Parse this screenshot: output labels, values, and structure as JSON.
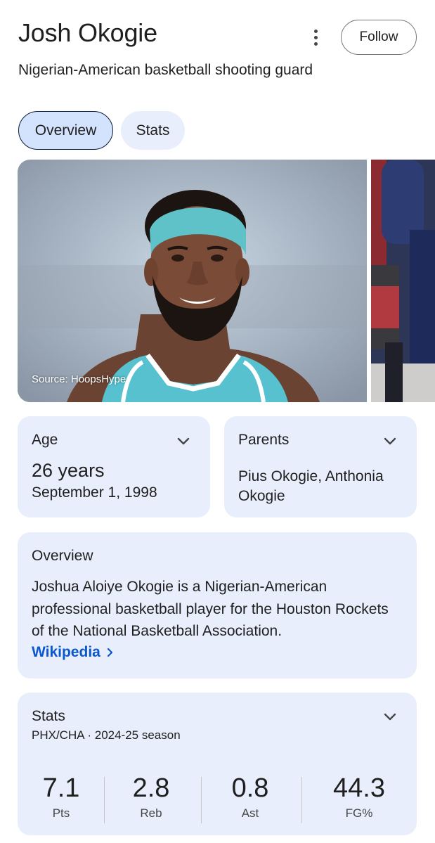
{
  "header": {
    "title": "Josh Okogie",
    "subtitle": "Nigerian-American basketball shooting guard",
    "follow_label": "Follow"
  },
  "tabs": [
    {
      "label": "Overview",
      "selected": true
    },
    {
      "label": "Stats",
      "selected": false
    }
  ],
  "image": {
    "source_label": "Source: HoopsHype"
  },
  "age": {
    "label": "Age",
    "value": "26 years",
    "date": "September 1, 1998"
  },
  "parents": {
    "label": "Parents",
    "value": "Pius Okogie, Anthonia Okogie"
  },
  "overview": {
    "label": "Overview",
    "text": "Joshua Aloiye Okogie is a Nigerian-American professional basketball player for the Houston Rockets of the National Basketball Association.",
    "link_label": "Wikipedia"
  },
  "stats": {
    "label": "Stats",
    "subtitle": "PHX/CHA · 2024-25 season",
    "items": [
      {
        "value": "7.1",
        "label": "Pts"
      },
      {
        "value": "2.8",
        "label": "Reb"
      },
      {
        "value": "0.8",
        "label": "Ast"
      },
      {
        "value": "44.3",
        "label": "FG%"
      }
    ]
  },
  "colors": {
    "card_bg": "#e8eefb",
    "tab_selected_bg": "#d3e3fd",
    "link": "#0b57d0",
    "headband": "#5fc2c9",
    "jersey": "#57c1cf"
  }
}
